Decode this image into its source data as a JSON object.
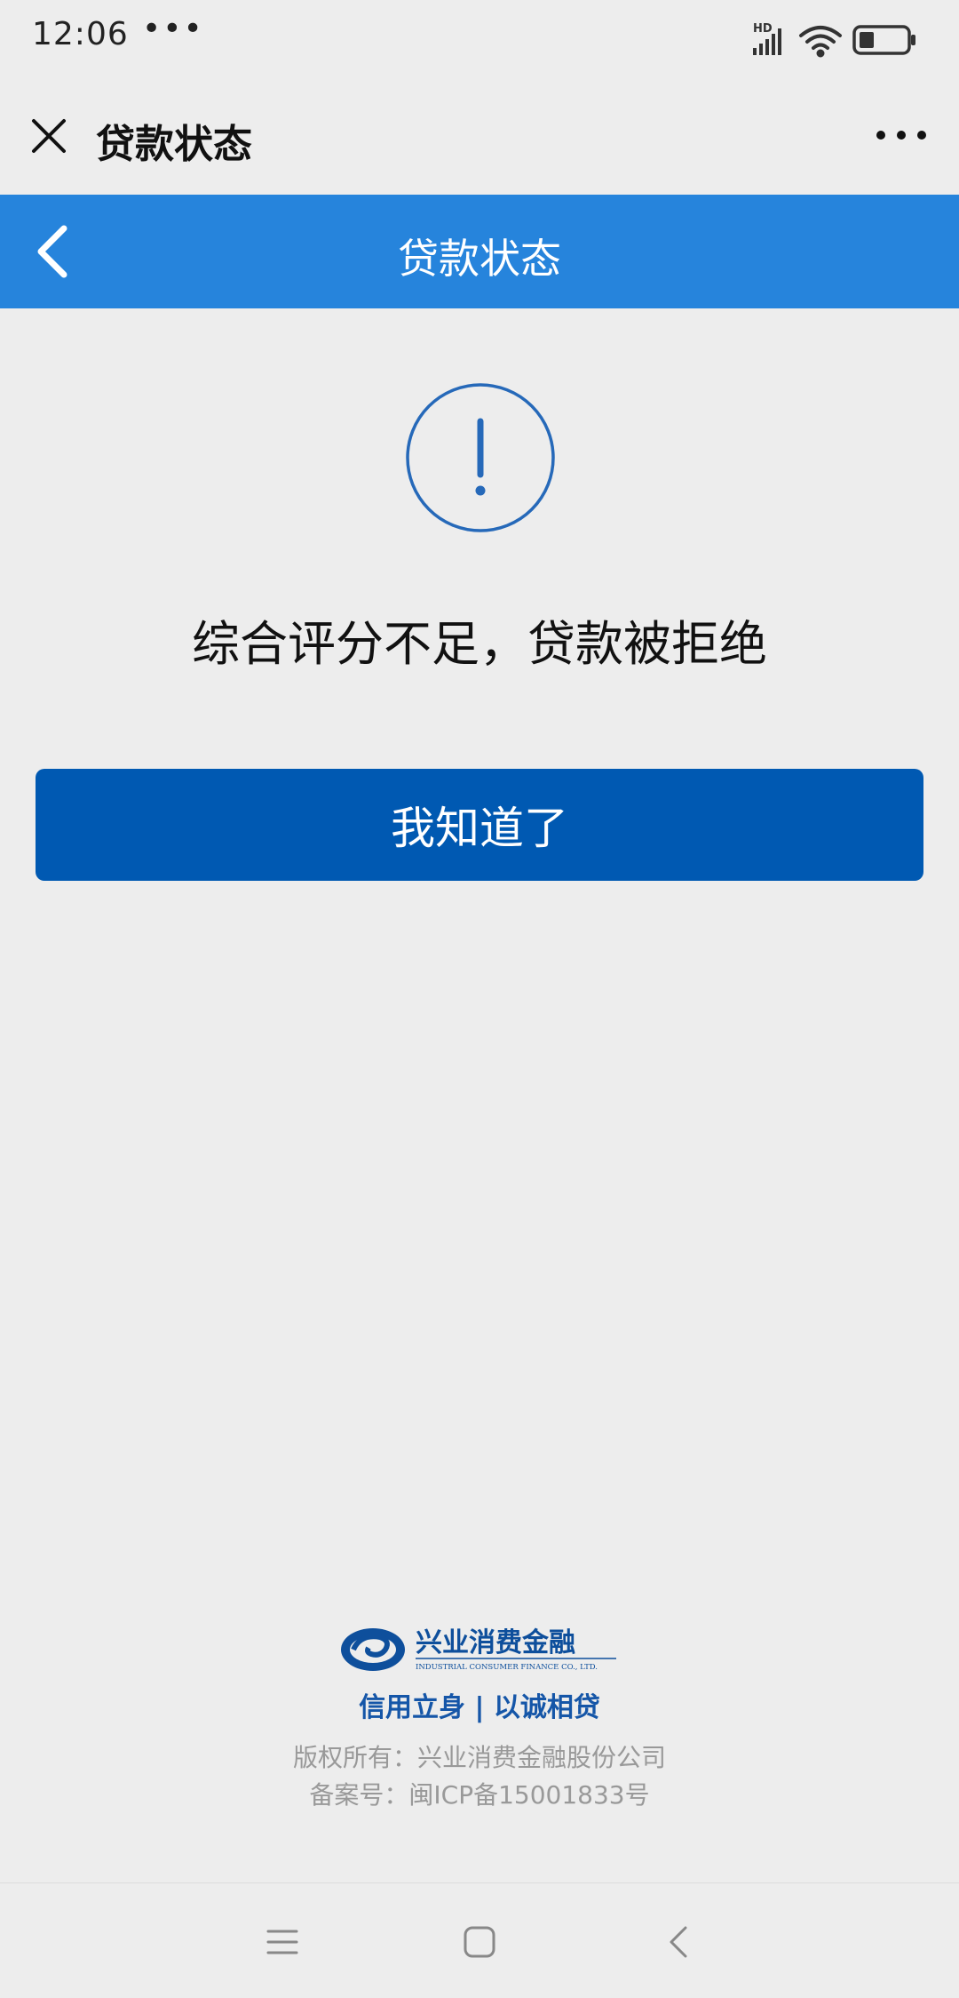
{
  "status_bar": {
    "time": "12:06",
    "more_dots": "•••",
    "icons": [
      "hd-signal-icon",
      "wifi-icon",
      "battery-icon"
    ],
    "network_label": "HD"
  },
  "wechat_header": {
    "title": "贷款状态",
    "close_icon": "close-icon",
    "more_icon": "more-icon"
  },
  "app_nav": {
    "title": "贷款状态",
    "back_icon": "chevron-left-icon",
    "background": "#2684dc"
  },
  "result": {
    "icon": "exclamation-circle-icon",
    "message": "综合评分不足，贷款被拒绝",
    "button_label": "我知道了",
    "button_color": "#0059b2"
  },
  "footer": {
    "logo_cn": "兴业消费金融",
    "logo_en": "INDUSTRIAL CONSUMER FINANCE CO., LTD.",
    "slogan": "信用立身 | 以诚相贷",
    "copyright": "版权所有：兴业消费金融股份公司",
    "icp": "备案号：闽ICP备15001833号"
  },
  "system_nav": {
    "icons": [
      "menu-icon",
      "home-icon",
      "back-icon"
    ]
  }
}
